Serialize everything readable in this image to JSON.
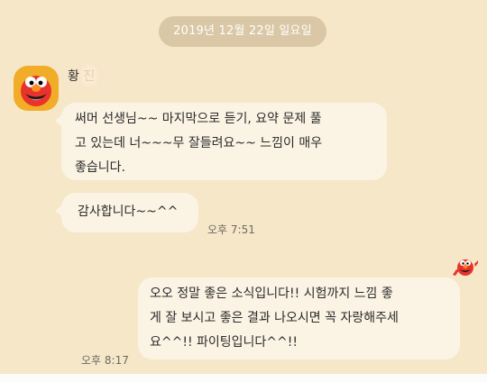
{
  "chat": {
    "date": "2019년 12월 22일 일요일",
    "sender": {
      "name": "황 진",
      "avatar_icon": "elmo-avatar-icon"
    },
    "messages": [
      {
        "text": "써머 선생님~~ 마지막으로 듣기, 요약 문제 풀\n고 있는데 너~~~무 잘들려요~~  느낌이 매우\n좋습니다."
      },
      {
        "text": "감사합니다~~^^",
        "time": "오후 7:51"
      },
      {
        "text": "오오 정말 좋은 소식입니다!! 시험까지 느낌 좋\n게 잘 보시고 좋은 결과 나오시면 꼭 자랑해주세\n요^^!! 파이팅입니다^^!!",
        "time": "오후 8:17",
        "avatar_icon": "elmo-mini-icon"
      }
    ]
  },
  "colors": {
    "background": "#f6e7c9",
    "bubble": "#fbf3e4",
    "date_pill": "#d9c7a6",
    "avatar_bg": "#f1ad27",
    "elmo_red": "#e7332b"
  }
}
